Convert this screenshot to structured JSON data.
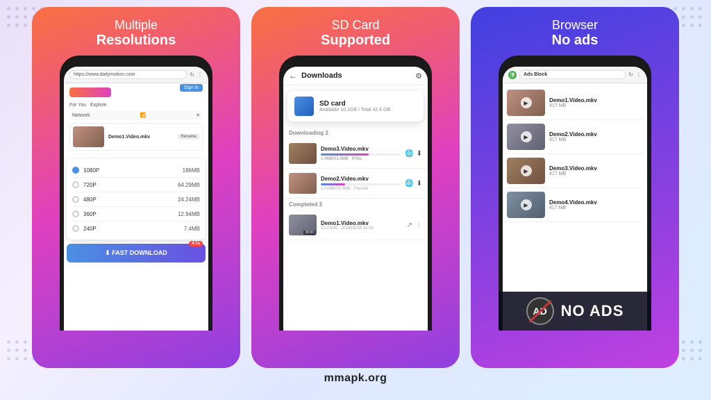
{
  "page": {
    "background_color": "#f0eeff",
    "bottom_label": "mmapk.org"
  },
  "cards": [
    {
      "id": "card1",
      "title_line1": "Multiple",
      "title_line2": "Resolutions",
      "browser_url": "https://www.dailymotion.com",
      "signin_label": "Sign in",
      "network_label": "Network",
      "video_name": "Demo1.Video.mkv",
      "rename_label": "Rename",
      "resolutions": [
        {
          "label": "1080P",
          "size": "186MB",
          "checked": true
        },
        {
          "label": "720P",
          "size": "64.29MB",
          "checked": false
        },
        {
          "label": "480P",
          "size": "24.24MB",
          "checked": false
        },
        {
          "label": "360P",
          "size": "12.94MB",
          "checked": false
        },
        {
          "label": "240P",
          "size": "7.4MB",
          "checked": false
        }
      ],
      "download_btn": "FAST DOWNLOAD",
      "badge_label": "4 1s"
    },
    {
      "id": "card2",
      "title_line1": "SD Card",
      "title_line2": "Supported",
      "header_title": "Downloads",
      "sdcard_name": "SD card",
      "sdcard_space": "Available 10.1GB / Total 42.6 GB",
      "downloading_label": "Downloading  2",
      "completed_label": "Completed  3",
      "downloading_items": [
        {
          "name": "Demo3.Video.mkv",
          "progress": 60,
          "speed": "876/s",
          "size_done": "1.4MB/01.5MB"
        },
        {
          "name": "Demo2.Video.mkv",
          "progress": 30,
          "status": "Paused",
          "size_done": "1.01MB/01.5MB"
        }
      ],
      "completed_items": [
        {
          "name": "Demo1.Video.mkv",
          "size": "13.21MB",
          "date": "2019/06/28  16:04",
          "duration": "30:00"
        }
      ]
    },
    {
      "id": "card3",
      "title_line1": "Browser",
      "title_line2": "No ads",
      "ads_block_label": "Ads Block",
      "videos": [
        {
          "name": "Demo1.Video.mkv",
          "size": "417 MB"
        },
        {
          "name": "Demo2.Video.mkv",
          "size": "417 MB"
        },
        {
          "name": "Demo3.Video.mkv",
          "size": "417 MB"
        },
        {
          "name": "Demo4.Video.mkv",
          "size": "417 MB"
        }
      ],
      "no_ads_text": "NO ADS",
      "ad_icon": "AD"
    }
  ]
}
